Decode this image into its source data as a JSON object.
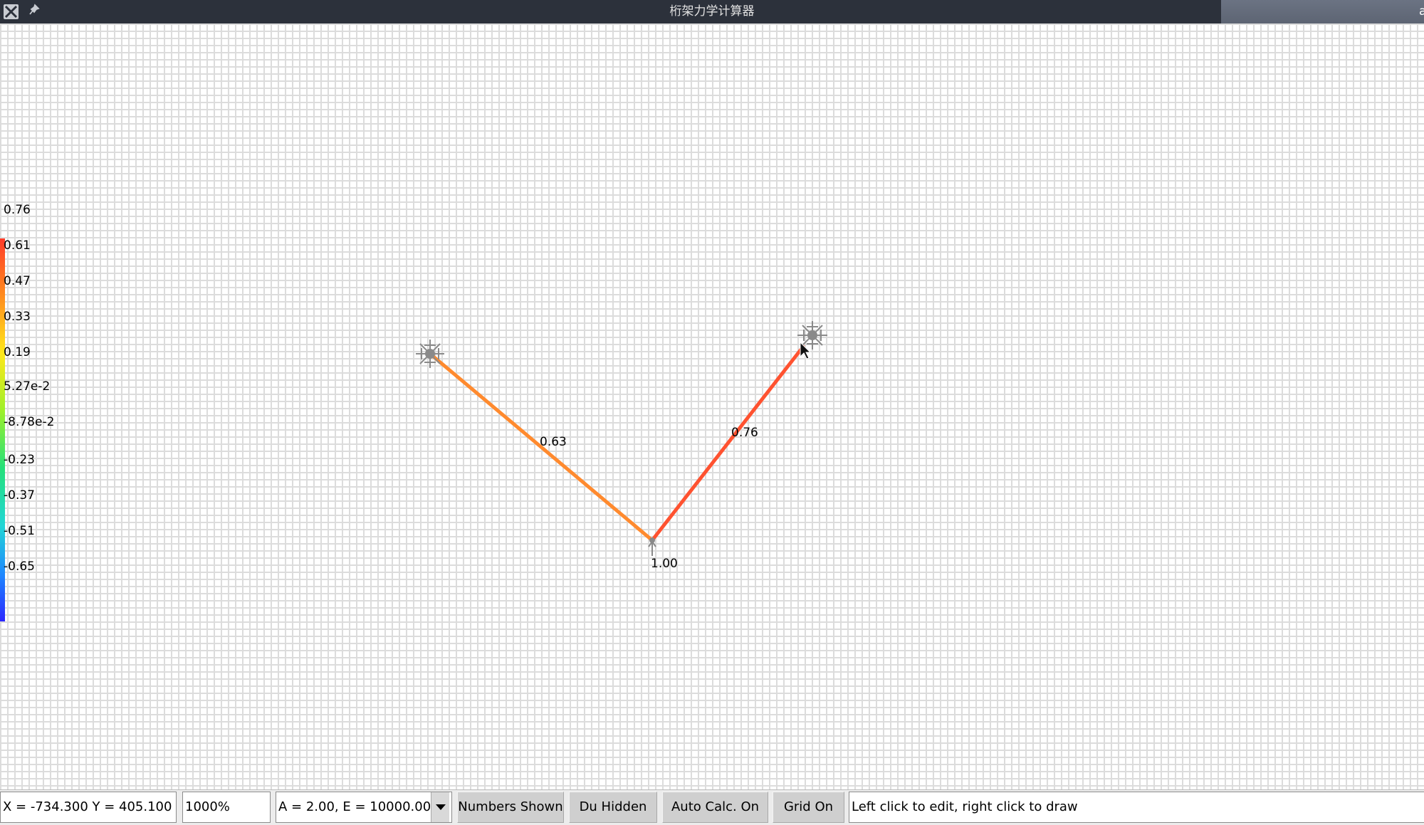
{
  "window": {
    "title": "桁架力学计算器",
    "app_icon": "x11-icon",
    "pin_icon": "pin-icon",
    "overlay_glyph": "a"
  },
  "color_scale": {
    "labels": [
      "0.76",
      "0.61",
      "0.47",
      "0.33",
      "0.19",
      "5.27e-2",
      "-8.78e-2",
      "-0.23",
      "-0.37",
      "-0.51",
      "-0.65"
    ],
    "gradient_colors": [
      "#ff3b28",
      "#ff8c1e",
      "#ffe81a",
      "#9ef02a",
      "#24e07a",
      "#22d6d6",
      "#1e86ff",
      "#2b27ff"
    ]
  },
  "truss": {
    "nodes": [
      {
        "id": "support-left",
        "type": "fixed-support"
      },
      {
        "id": "load-node",
        "type": "loaded-node",
        "load_label": "1.00"
      },
      {
        "id": "support-right",
        "type": "fixed-support"
      }
    ],
    "members": [
      {
        "id": "member-left",
        "from": "support-left",
        "to": "load-node",
        "force": "0.63",
        "color": "#ff8a2e"
      },
      {
        "id": "member-right",
        "from": "load-node",
        "to": "support-right",
        "force": "0.76",
        "color": "#ff5230"
      }
    ],
    "support_color": "#8a8a8a"
  },
  "toolbar": {
    "coords": "X = -734.300 Y = 405.100",
    "zoom": "1000%",
    "material_select": "A = 2.00, E = 10000.00",
    "numbers_button": "Numbers Shown",
    "du_button": "Du Hidden",
    "autocalc_button": "Auto Calc. On",
    "grid_button": "Grid On",
    "hint": "Left click to edit, right click to draw"
  }
}
